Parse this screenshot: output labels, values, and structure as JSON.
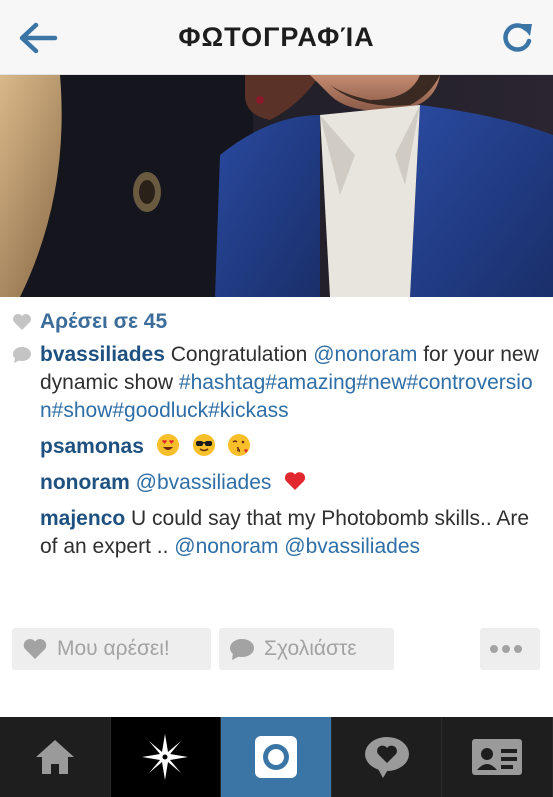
{
  "header": {
    "title": "ΦΩΤΟΓΡΑΦΊΑ",
    "back_icon": "back-arrow-icon",
    "refresh_icon": "refresh-icon"
  },
  "post": {
    "photo_alt": "photo",
    "likes": "Αρέσει σε 45",
    "comments": [
      {
        "user": "bvassiliades",
        "text_1": " Congratulation ",
        "mention_1": "@nonoram",
        "text_2": " for your new dynamic show ",
        "hashtags": "#hashtag#amazing#new#controversion#show#goodluck#kickass"
      },
      {
        "user": "psamonas",
        "emojis": [
          "heart-eyes-emoji",
          "sunglasses-emoji",
          "kissing-heart-emoji"
        ]
      },
      {
        "user": "nonoram",
        "mention": " @bvassiliades",
        "emoji": "red-heart-emoji"
      },
      {
        "user": "majenco",
        "text": " U could say that my Photobomb skills.. Are of an expert .. ",
        "mention_1": "@nonoram",
        "mention_2": "@bvassiliades"
      }
    ]
  },
  "actions": {
    "like_label": "Μου αρέσει!",
    "comment_label": "Σχολιάστε",
    "more_icon": "more-dots-icon"
  },
  "tabbar": {
    "items": [
      "home-icon",
      "explore-icon",
      "camera-icon",
      "activity-icon",
      "profile-icon"
    ],
    "active": "camera-icon"
  },
  "colors": {
    "accent": "#3a75a6",
    "link": "#2f6ea6",
    "username": "#1e5180",
    "tabbar": "#1e1e1e"
  }
}
